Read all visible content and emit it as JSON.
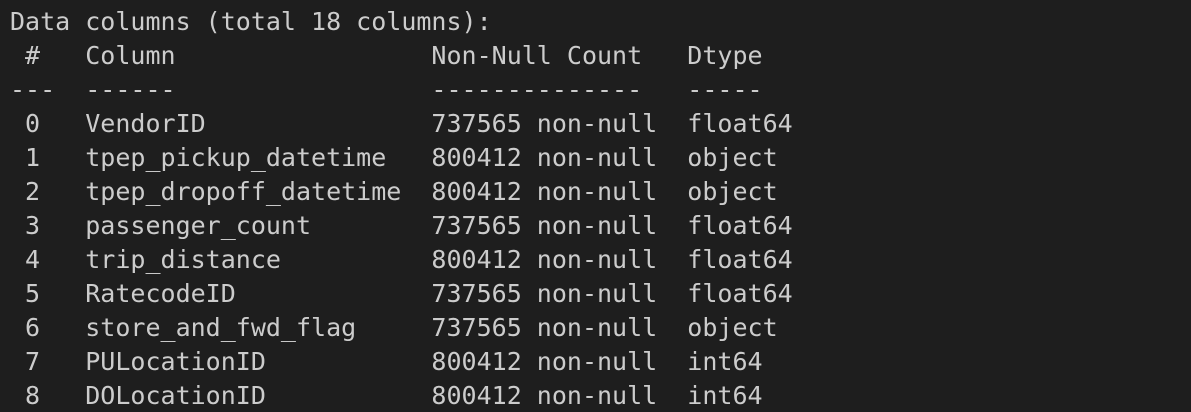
{
  "output": {
    "lines": [
      "Data columns (total 18 columns):",
      " #   Column                 Non-Null Count   Dtype  ",
      "---  ------                 --------------   -----  ",
      " 0   VendorID               737565 non-null  float64",
      " 1   tpep_pickup_datetime   800412 non-null  object ",
      " 2   tpep_dropoff_datetime  800412 non-null  object ",
      " 3   passenger_count        737565 non-null  float64",
      " 4   trip_distance          800412 non-null  float64",
      " 5   RatecodeID             737565 non-null  float64",
      " 6   store_and_fwd_flag     737565 non-null  object ",
      " 7   PULocationID           800412 non-null  int64  ",
      " 8   DOLocationID           800412 non-null  int64  "
    ]
  }
}
